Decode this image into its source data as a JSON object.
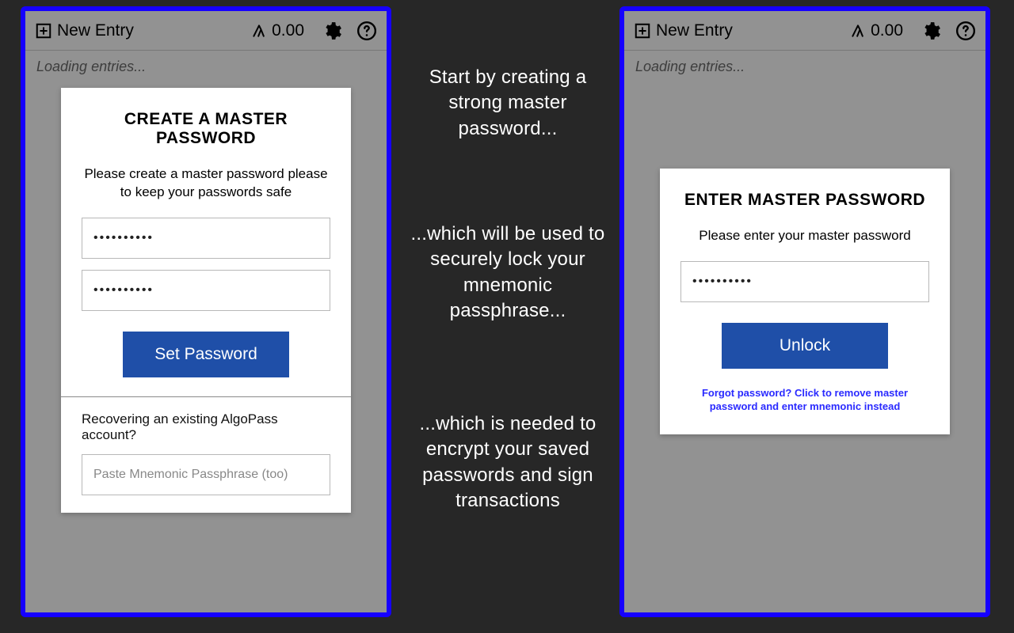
{
  "topbar": {
    "new_entry_label": "New Entry",
    "balance_value": "0.00"
  },
  "loading_text": "Loading entries...",
  "create": {
    "title": "CREATE A MASTER PASSWORD",
    "subtitle": "Please create a master password please to keep your passwords safe",
    "password1_value": "••••••••••",
    "password2_value": "••••••••••",
    "set_button": "Set Password",
    "recover_label": "Recovering an existing AlgoPass account?",
    "mnemonic_placeholder": "Paste Mnemonic Passphrase (too)"
  },
  "enter": {
    "title": "ENTER MASTER PASSWORD",
    "subtitle": "Please enter your master password",
    "password_value": "••••••••••",
    "unlock_button": "Unlock",
    "forgot": "Forgot password? Click to remove master password and enter mnemonic instead"
  },
  "annotations": {
    "a1": "Start by creating a strong master password...",
    "a2": "...which will be used to securely lock your mnemonic passphrase...",
    "a3": "...which is needed to encrypt your saved passwords and sign transactions"
  },
  "colors": {
    "frame_border": "#1600ff",
    "primary_button": "#1f4fa8",
    "background": "#272727"
  }
}
